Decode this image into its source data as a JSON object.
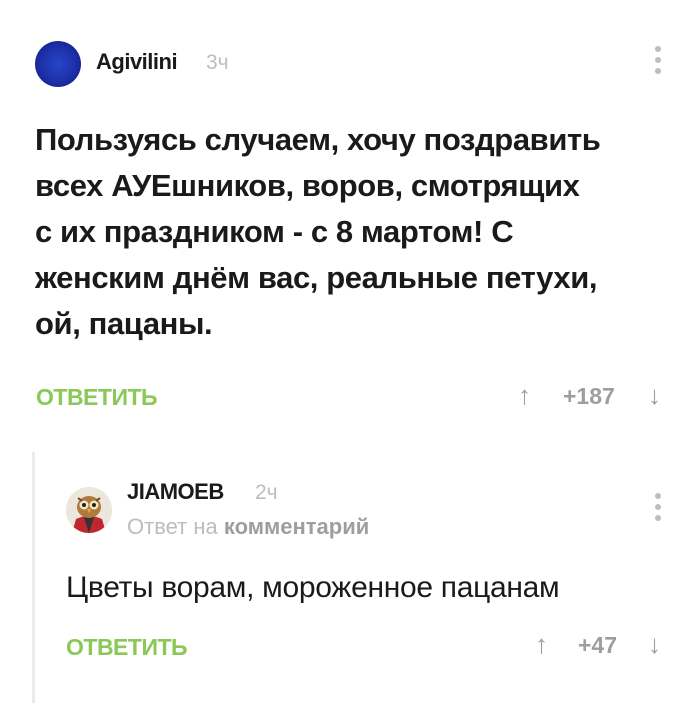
{
  "main_comment": {
    "username": "Agivilini",
    "time": "3ч",
    "lines": [
      "Пользуясь случаем, хочу поздравить",
      "всех АУЕшников, воров, смотрящих",
      "с их праздником - с 8 мартом! С",
      "женским днём вас, реальные петухи,",
      "ой, пацаны."
    ],
    "reply_label": "ОТВЕТИТЬ",
    "upvote_icon": "↑",
    "score": "+187",
    "downvote_icon": "↓"
  },
  "reply_comment": {
    "username": "JIAMOEB",
    "time": "2ч",
    "answer_prefix": "Ответ на",
    "answer_link": "комментарий",
    "text": "Цветы ворам, мороженное пацанам",
    "reply_label": "ОТВЕТИТЬ",
    "upvote_icon": "↑",
    "score": "+47",
    "downvote_icon": "↓"
  },
  "colors": {
    "accent_green": "#8ac858",
    "muted_gray": "#bdbdbd",
    "text_dark": "#1a1a1a"
  }
}
